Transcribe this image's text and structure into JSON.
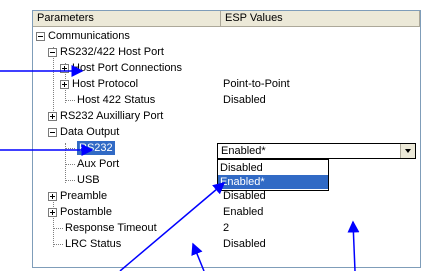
{
  "window": {
    "headers": {
      "col1": "Parameters",
      "col2": "ESP Values"
    }
  },
  "tree": [
    {
      "label": "Communications",
      "value": ""
    },
    {
      "label": "RS232/422 Host Port",
      "value": ""
    },
    {
      "label": "Host Port Connections",
      "value": ""
    },
    {
      "label": "Host Protocol",
      "value": "Point-to-Point"
    },
    {
      "label": "Host 422 Status",
      "value": "Disabled"
    },
    {
      "label": "RS232 Auxilliary Port",
      "value": ""
    },
    {
      "label": "Data Output",
      "value": ""
    },
    {
      "label": "RS232",
      "value": "Enabled*"
    },
    {
      "label": "Aux Port",
      "value": ""
    },
    {
      "label": "USB",
      "value": ""
    },
    {
      "label": "Preamble",
      "value": "Disabled"
    },
    {
      "label": "Postamble",
      "value": "Enabled"
    },
    {
      "label": "Response Timeout",
      "value": "2"
    },
    {
      "label": "LRC Status",
      "value": "Disabled"
    }
  ],
  "dropdown": {
    "selected": "Enabled*",
    "options": [
      "Disabled",
      "Enabled*"
    ],
    "highlighted_index": 1
  },
  "colors": {
    "selection": "#316ac5",
    "header_bg": "#ece9d8",
    "arrow": "#0000ff"
  }
}
